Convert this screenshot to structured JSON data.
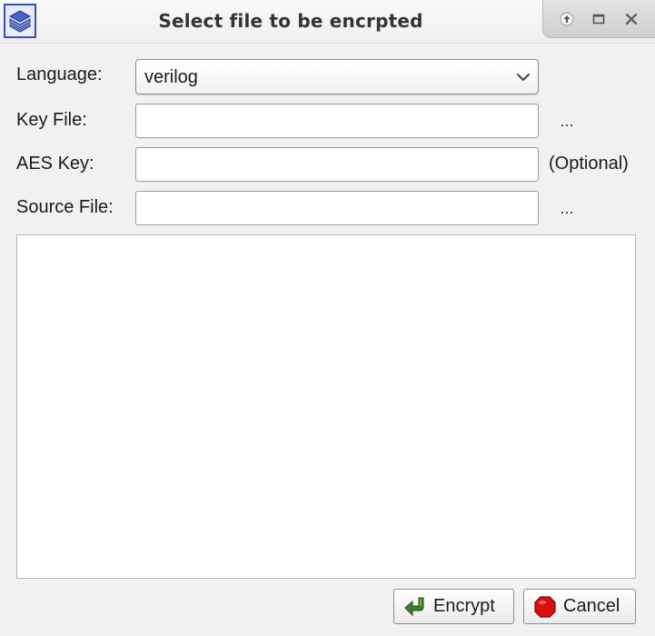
{
  "window": {
    "title": "Select file to be encrpted",
    "controls": [
      "arrow-up-icon",
      "maximize-icon",
      "close-icon"
    ]
  },
  "form": {
    "language_label": "Language:",
    "language_value": "verilog",
    "key_file_label": "Key File:",
    "key_file_value": "",
    "key_file_browse": "...",
    "aes_key_label": "AES Key:",
    "aes_key_value": "",
    "aes_key_hint": "(Optional)",
    "source_file_label": "Source File:",
    "source_file_value": "",
    "source_file_browse": "...",
    "output_text": ""
  },
  "buttons": {
    "encrypt_label": "Encrypt",
    "cancel_label": "Cancel"
  },
  "colors": {
    "accent_blue": "#3b4fb0",
    "encrypt_green": "#3f7a2a",
    "cancel_red": "#d81010"
  }
}
